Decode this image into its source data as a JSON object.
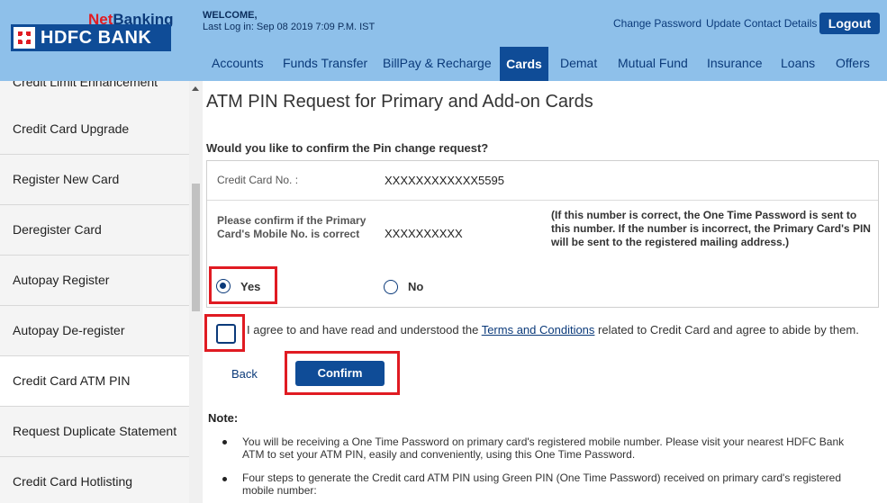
{
  "brand": {
    "net": "Net",
    "banking": "Banking",
    "bank_name": "HDFC BANK"
  },
  "header": {
    "welcome": "WELCOME,",
    "last_login": "Last Log in: Sep 08 2019 7:09 P.M. IST",
    "change_password": "Change Password",
    "update_contact": "Update Contact Details",
    "logout": "Logout"
  },
  "nav": {
    "accounts": "Accounts",
    "funds_transfer": "Funds Transfer",
    "billpay": "BillPay & Recharge",
    "cards": "Cards",
    "demat": "Demat",
    "mutual_fund": "Mutual Fund",
    "insurance": "Insurance",
    "loans": "Loans",
    "offers": "Offers"
  },
  "sidebar": {
    "items": [
      {
        "label": "Credit Limit Enhancement"
      },
      {
        "label": "Credit Card Upgrade"
      },
      {
        "label": "Register New Card"
      },
      {
        "label": "Deregister Card"
      },
      {
        "label": "Autopay Register"
      },
      {
        "label": "Autopay De-register"
      },
      {
        "label": "Credit Card ATM PIN"
      },
      {
        "label": "Request Duplicate Statement"
      },
      {
        "label": "Credit Card Hotlisting"
      }
    ]
  },
  "main": {
    "title": "ATM PIN Request for Primary and Add-on Cards",
    "question": "Would you like to confirm the Pin change request?",
    "card_label": "Credit Card No. :",
    "card_value": "XXXXXXXXXXXX5595",
    "mobile_label": "Please confirm if the Primary Card's Mobile No. is correct",
    "mobile_value": "XXXXXXXXXX",
    "mobile_note": "(If this number is correct, the One Time Password is sent to this number. If the number is incorrect, the Primary Card's PIN will be sent to the registered mailing address.)",
    "yes": "Yes",
    "no": "No",
    "agree_pre": "I agree to and have read and understood the ",
    "agree_link": "Terms and Conditions",
    "agree_post": " related to Credit Card and agree to abide by them.",
    "back": "Back",
    "confirm": "Confirm",
    "note_head": "Note:",
    "notes": [
      "You will be receiving a One Time Password on primary card's registered mobile number. Please visit your nearest HDFC Bank ATM to set your ATM PIN, easily and conveniently, using this One Time Password.",
      "Four steps to generate the Credit card ATM PIN using Green PIN (One Time Password) received on primary card's registered mobile number:"
    ]
  },
  "colors": {
    "header_bg": "#8ec0ea",
    "brand_blue": "#0f4c97",
    "brand_red": "#e01b22",
    "highlight_red": "#e01b22"
  }
}
